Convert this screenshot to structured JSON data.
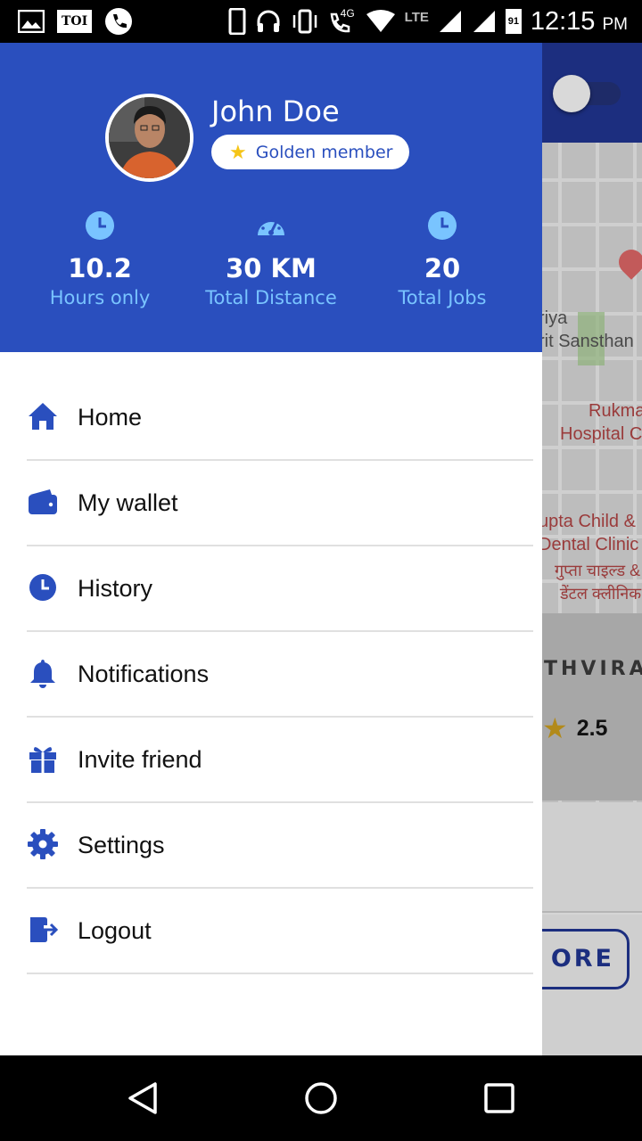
{
  "status_bar": {
    "left_icons": [
      "image-icon",
      "toi-app-icon",
      "phone-icon"
    ],
    "toi_label": "TOI",
    "net_badge": "4G",
    "lte_label": "LTE",
    "battery_level": "91",
    "time": "12:15",
    "ampm": "PM"
  },
  "background": {
    "map_labels": [
      "riya",
      "rit Sansthan",
      "Rukma",
      "Hospital C",
      "upta Child &",
      "Dental Clinic",
      "गुप्ता चाइल्ड &",
      "डेंटल क्लीनिक"
    ],
    "road_label": "THVIRAJ",
    "rating": "2.5",
    "more_button": "ORE"
  },
  "drawer": {
    "user_name": "John Doe",
    "membership": "Golden member",
    "stats": [
      {
        "value": "10.2",
        "label": "Hours only",
        "icon": "clock-icon"
      },
      {
        "value": "30 KM",
        "label": "Total Distance",
        "icon": "speedometer-icon"
      },
      {
        "value": "20",
        "label": "Total Jobs",
        "icon": "clock-icon"
      }
    ],
    "menu": [
      {
        "label": "Home",
        "icon": "home-icon"
      },
      {
        "label": "My wallet",
        "icon": "wallet-icon"
      },
      {
        "label": "History",
        "icon": "history-icon"
      },
      {
        "label": "Notifications",
        "icon": "bell-icon"
      },
      {
        "label": "Invite friend",
        "icon": "gift-icon"
      },
      {
        "label": "Settings",
        "icon": "gear-icon"
      },
      {
        "label": "Logout",
        "icon": "logout-icon"
      }
    ]
  },
  "colors": {
    "drawer_header": "#2a4fbe",
    "accent": "#2a4fbe",
    "stat_label": "#79c4ff",
    "star": "#f5c518"
  }
}
